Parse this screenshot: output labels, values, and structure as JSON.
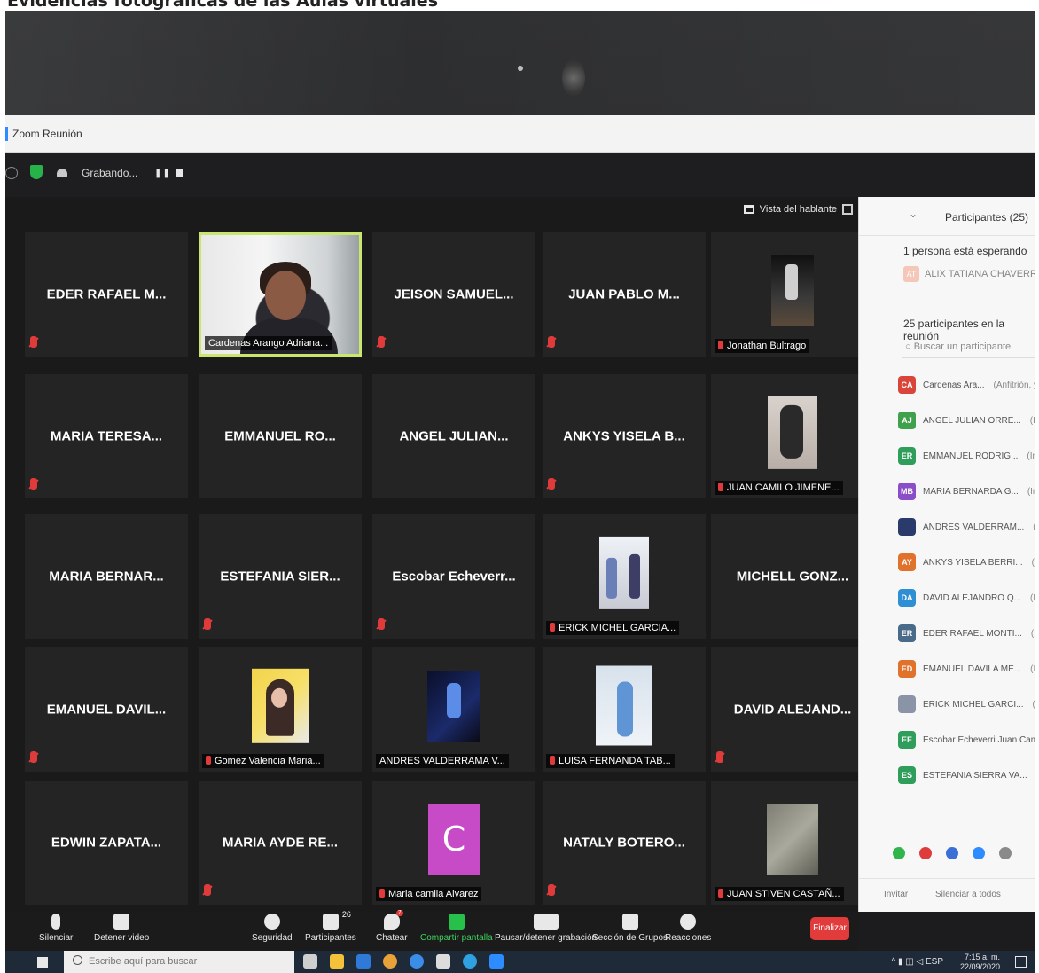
{
  "caption": "Evidencias fotográficas de las Aulas virtuales",
  "window": {
    "title": "Zoom Reunión"
  },
  "status": {
    "recording": "Grabando..."
  },
  "view": {
    "speaker_view": "Vista del hablante"
  },
  "tiles": [
    {
      "name": "EDER RAFAEL M...",
      "muted": true
    },
    {
      "label": "Cardenas Arango Adriana...",
      "video": "webcam",
      "active": true
    },
    {
      "name": "JEISON SAMUEL...",
      "muted": true
    },
    {
      "name": "JUAN PABLO M...",
      "muted": true
    },
    {
      "label": "Jonathan Bultrago",
      "thumb": "jonathan",
      "muted": true
    },
    {
      "name": "MARIA TERESA...",
      "muted": true
    },
    {
      "name": "EMMANUEL RO..."
    },
    {
      "name": "ANGEL JULIAN..."
    },
    {
      "name": "ANKYS YISELA B...",
      "muted": true
    },
    {
      "label": "JUAN CAMILO JIMENE...",
      "thumb": "camilo",
      "muted": true
    },
    {
      "name": "MARIA BERNAR..."
    },
    {
      "name": "ESTEFANIA SIER...",
      "muted": true
    },
    {
      "name": "Escobar Echeverr...",
      "muted": true
    },
    {
      "label": "ERICK MICHEL GARCIA...",
      "thumb": "erick",
      "muted": true
    },
    {
      "name": "MICHELL GONZ..."
    },
    {
      "name": "EMANUEL DAVIL...",
      "muted": true
    },
    {
      "label": "Gomez Valencia Maria...",
      "thumb": "gomez",
      "muted": true
    },
    {
      "label": "ANDRES VALDERRAMA V...",
      "thumb": "andres"
    },
    {
      "label": "LUISA FERNANDA TAB...",
      "thumb": "luisa",
      "muted": true
    },
    {
      "name": "DAVID ALEJAND...",
      "muted": true
    },
    {
      "name": "EDWIN ZAPATA..."
    },
    {
      "name": "MARIA AYDE RE...",
      "muted": true
    },
    {
      "label": "Maria camila Alvarez",
      "thumb": "maria",
      "letter": "C",
      "muted": true
    },
    {
      "name": "NATALY BOTERO...",
      "muted": true
    },
    {
      "label": "JUAN STIVEN CASTAÑ...",
      "thumb": "stiven",
      "muted": true
    }
  ],
  "sidebar": {
    "title": "Participantes (25)",
    "waiting": "1 persona está esperando",
    "waiting_person": {
      "initials": "AT",
      "name": "ALIX TATIANA CHAVERRA GARC"
    },
    "count_label": "25 participantes en la reunión",
    "search_placeholder": "Buscar un participante",
    "participants": [
      {
        "initials": "CA",
        "name": "Cardenas Ara...",
        "tag": "(Anfitrión, yo)",
        "color": "#d9453a"
      },
      {
        "initials": "AJ",
        "name": "ANGEL JULIAN ORRE...",
        "tag": "(Invitado)",
        "color": "#3fa14b"
      },
      {
        "initials": "ER",
        "name": "EMMANUEL RODRIG...",
        "tag": "(Invitado)",
        "color": "#2f9e5a"
      },
      {
        "initials": "MB",
        "name": "MARIA BERNARDA G...",
        "tag": "(Invitado)",
        "color": "#8a4fc8"
      },
      {
        "initials": "",
        "name": "ANDRES VALDERRAM...",
        "tag": "(Invitado)",
        "color": "#2a3a6a"
      },
      {
        "initials": "AY",
        "name": "ANKYS YISELA BERRI...",
        "tag": "(Invitado)",
        "color": "#e0722c"
      },
      {
        "initials": "DA",
        "name": "DAVID ALEJANDRO Q...",
        "tag": "(Invitado)",
        "color": "#2f8fd4"
      },
      {
        "initials": "ER",
        "name": "EDER RAFAEL MONTI...",
        "tag": "(Invitado)",
        "color": "#4a6a8a"
      },
      {
        "initials": "ED",
        "name": "EMANUEL DAVILA ME...",
        "tag": "(Invitado)",
        "color": "#e0722c"
      },
      {
        "initials": "",
        "name": "ERICK MICHEL GARCI...",
        "tag": "(Invitado)",
        "color": "#8a94a6"
      },
      {
        "initials": "EE",
        "name": "Escobar Echeverri Juan Camilo (...",
        "tag": "",
        "color": "#2f9e5a"
      },
      {
        "initials": "ES",
        "name": "ESTEFANIA SIERRA VA...",
        "tag": "(Invitado)",
        "color": "#2f9e5a"
      }
    ],
    "invite": "Invitar",
    "mute_all": "Silenciar a todos"
  },
  "toolbar": {
    "mute": "Silenciar",
    "video": "Detener video",
    "security": "Seguridad",
    "participants": "Participantes",
    "participants_count": "26",
    "chat": "Chatear",
    "chat_badge": "7",
    "share": "Compartir pantalla",
    "record": "Pausar/detener grabación",
    "breakout": "Sección de Grupos",
    "reactions": "Reacciones",
    "end": "Finalizar"
  },
  "taskbar": {
    "search_placeholder": "Escribe aquí para buscar",
    "lang": "ESP",
    "time": "7:15 a. m.",
    "date": "22/09/2020"
  }
}
